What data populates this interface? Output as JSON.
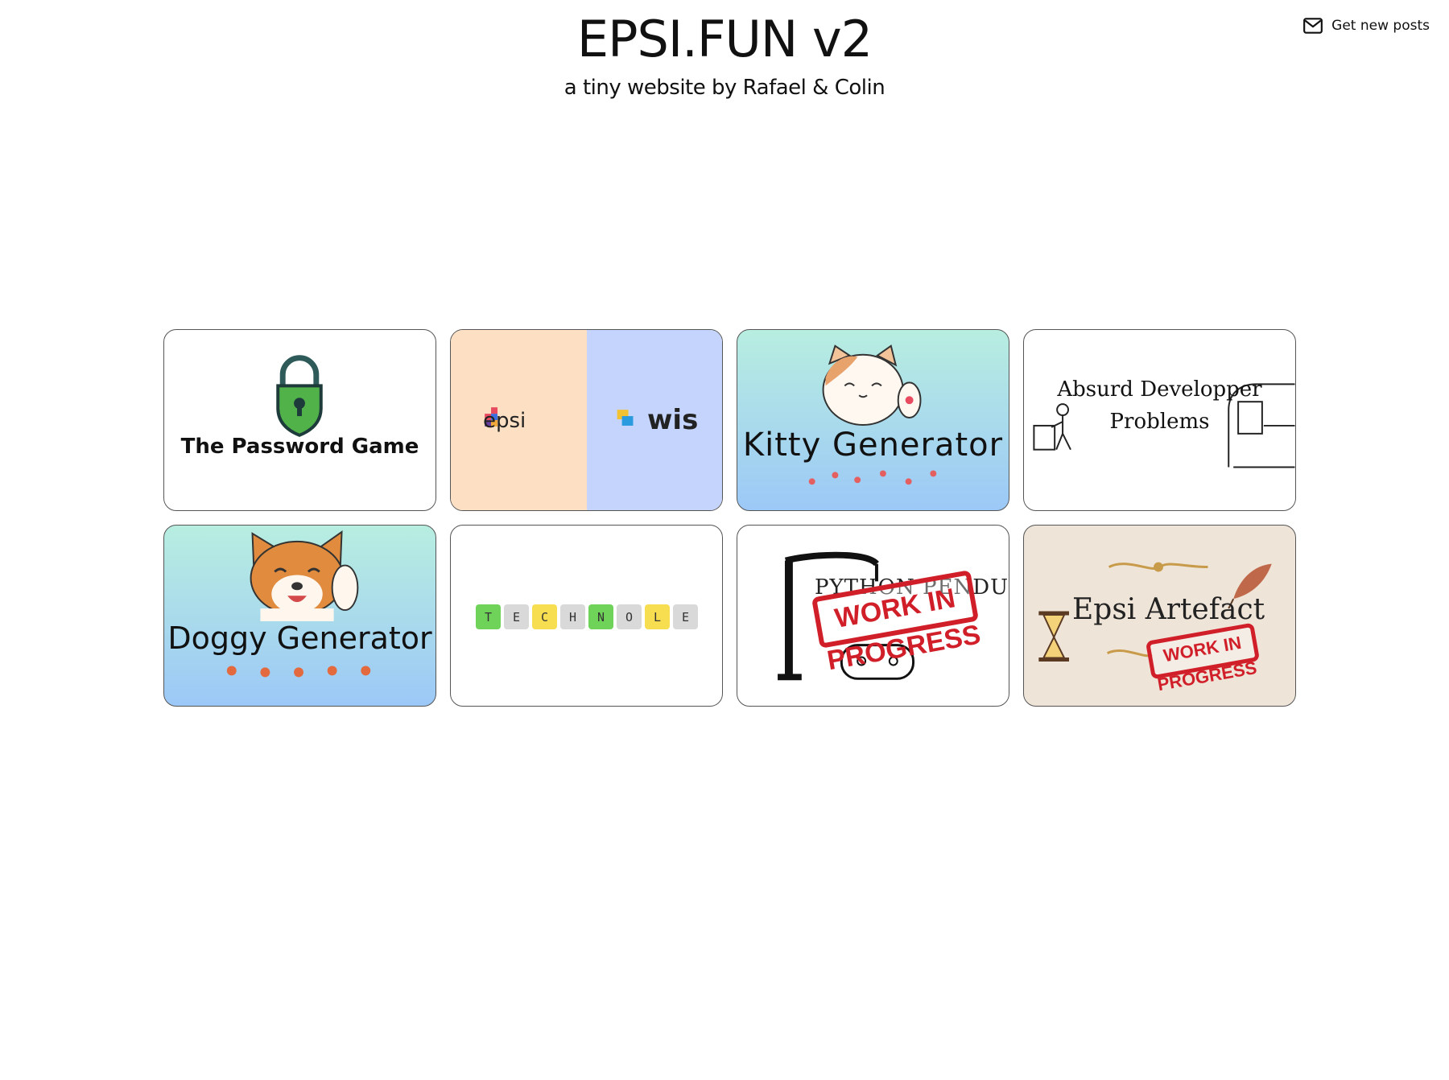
{
  "header": {
    "title": "EPSI.FUN v2",
    "subtitle": "a tiny website by Rafael & Colin",
    "subscribe_label": "Get new posts"
  },
  "cards": [
    {
      "label": "The Password Game"
    },
    {
      "left": "epsi",
      "right": "wis"
    },
    {
      "label": "Kitty Generator"
    },
    {
      "label_line1": "Absurd Developper",
      "label_line2": "Problems"
    },
    {
      "label": "Doggy Generator"
    },
    {
      "tiles": [
        "T",
        "E",
        "C",
        "H",
        "N",
        "O",
        "L",
        "E"
      ]
    },
    {
      "label": "PYTHON PENDU",
      "stamp": "WORK IN PROGRESS"
    },
    {
      "label": "Epsi Artefact",
      "stamp": "WORK IN PROGRESS"
    }
  ]
}
